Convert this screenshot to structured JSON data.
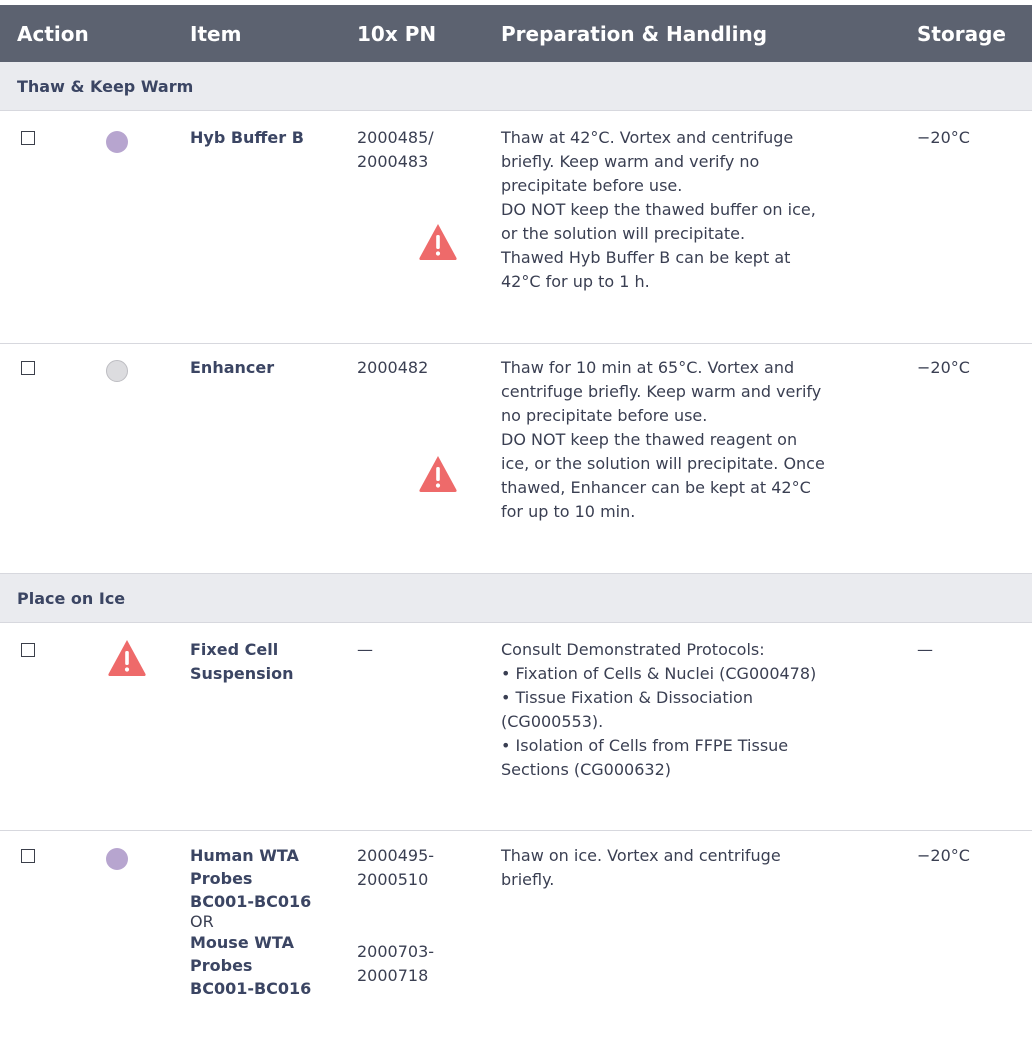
{
  "header": {
    "action": "Action",
    "item": "Item",
    "pn": "10x PN",
    "prep": "Preparation & Handling",
    "storage": "Storage"
  },
  "sections": [
    {
      "title": "Thaw & Keep Warm",
      "rows": [
        {
          "item": "Hyb Buffer B",
          "pn_lines": [
            "2000485/",
            "2000483"
          ],
          "prep_lines": [
            "Thaw at 42°C. Vortex and centrifuge",
            "briefly. Keep warm and verify no",
            "precipitate before use.",
            "DO NOT keep the thawed buffer on ice,",
            "or the solution will precipitate.",
            "Thawed Hyb Buffer B can be kept at",
            "42°C for up to 1 h."
          ],
          "storage": "−20°C"
        },
        {
          "item": "Enhancer",
          "pn": "2000482",
          "prep_lines": [
            "Thaw for 10 min at 65°C. Vortex and",
            "centrifuge briefly. Keep warm and verify",
            "no precipitate before use.",
            "DO NOT keep the thawed reagent on",
            "ice, or the solution will precipitate. Once",
            "thawed, Enhancer can be kept at 42°C",
            "for up to 10 min."
          ],
          "storage": "−20°C"
        }
      ]
    },
    {
      "title": "Place on Ice",
      "rows": [
        {
          "item_lines": [
            "Fixed Cell",
            "Suspension"
          ],
          "pn": "—",
          "prep_lines": [
            "Consult Demonstrated Protocols:",
            "• Fixation of Cells & Nuclei (CG000478)",
            "• Tissue Fixation & Dissociation",
            "(CG000553).",
            "• Isolation of Cells from FFPE Tissue",
            "Sections (CG000632)"
          ],
          "storage": "—"
        },
        {
          "item_lines_a": [
            "Human WTA",
            "Probes",
            "BC001-BC016"
          ],
          "or": "OR",
          "item_lines_b": [
            "Mouse WTA",
            "Probes",
            "BC001-BC016"
          ],
          "pn_a": [
            "2000495-",
            "2000510"
          ],
          "pn_b": [
            "2000703-",
            "2000718"
          ],
          "prep_lines": [
            "Thaw on ice. Vortex and centrifuge",
            "briefly."
          ],
          "storage": "−20°C"
        }
      ]
    }
  ],
  "colors": {
    "header_bg": "#5c6270",
    "section_bg": "#eaebef",
    "item_text": "#3b4563",
    "warning_red": "#ee6a6a",
    "dot_purple": "#b7a5cf",
    "dot_grey": "#dcdcdf"
  },
  "icons": [
    "checkbox-icon",
    "purple-tube-dot-icon",
    "grey-tube-dot-icon",
    "warning-triangle-icon"
  ]
}
